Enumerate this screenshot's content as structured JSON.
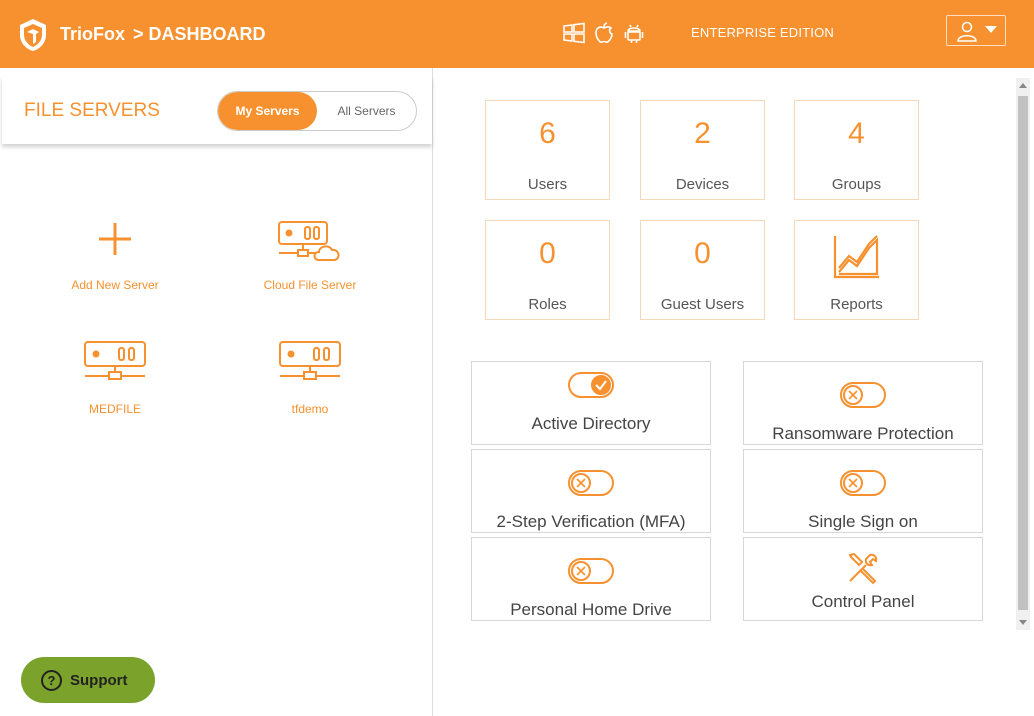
{
  "header": {
    "brand": "TrioFox",
    "breadcrumb": "> DASHBOARD",
    "edition": "ENTERPRISE EDITION",
    "platform_icons": [
      "windows-icon",
      "apple-icon",
      "android-icon"
    ],
    "accent_color": "#f7912f"
  },
  "file_servers": {
    "title": "FILE SERVERS",
    "toggle": {
      "active": "My Servers",
      "inactive": "All Servers"
    },
    "items": [
      {
        "label": "Add New Server",
        "icon": "plus-icon"
      },
      {
        "label": "Cloud File Server",
        "icon": "cloud-server-icon"
      },
      {
        "label": "MEDFILE",
        "icon": "server-icon"
      },
      {
        "label": "tfdemo",
        "icon": "server-icon"
      }
    ]
  },
  "stats": [
    {
      "value": "6",
      "label": "Users"
    },
    {
      "value": "2",
      "label": "Devices"
    },
    {
      "value": "4",
      "label": "Groups"
    },
    {
      "value": "0",
      "label": "Roles"
    },
    {
      "value": "0",
      "label": "Guest Users"
    },
    {
      "label": "Reports",
      "icon": "chart-icon"
    }
  ],
  "features": [
    {
      "label": "Active Directory",
      "state": "on"
    },
    {
      "label": "Ransomware Protection",
      "state": "off"
    },
    {
      "label": "2-Step Verification (MFA)",
      "state": "off"
    },
    {
      "label": "Single Sign on",
      "state": "off"
    },
    {
      "label": "Personal Home Drive",
      "state": "off"
    },
    {
      "label": "Control Panel",
      "icon": "tools-icon"
    }
  ],
  "support": {
    "label": "Support"
  }
}
